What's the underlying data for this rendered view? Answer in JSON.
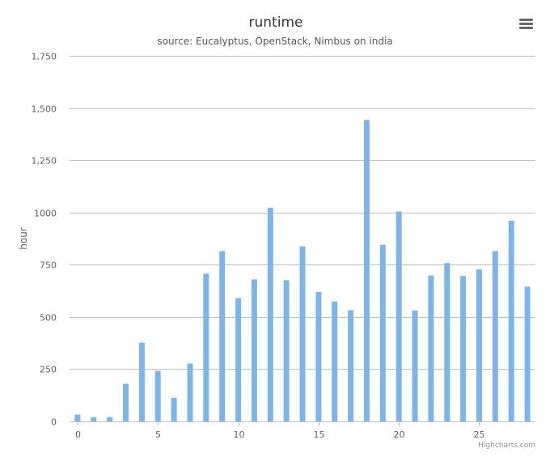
{
  "chart_data": {
    "type": "bar",
    "title": "runtime",
    "subtitle": "source: Eucalyptus, OpenStack, Nimbus on india",
    "xlabel": "",
    "ylabel": "hour",
    "x": [
      0,
      1,
      2,
      3,
      4,
      5,
      6,
      7,
      8,
      9,
      10,
      11,
      12,
      13,
      14,
      15,
      16,
      17,
      18,
      19,
      20,
      21,
      22,
      23,
      24,
      25,
      26,
      27,
      28
    ],
    "values": [
      32,
      20,
      20,
      180,
      377,
      242,
      113,
      277,
      707,
      815,
      590,
      680,
      1023,
      676,
      838,
      620,
      574,
      532,
      1443,
      845,
      1005,
      531,
      699,
      758,
      696,
      727,
      815,
      960,
      645
    ],
    "xlim": [
      -0.5,
      28.5
    ],
    "ylim": [
      0,
      1750
    ],
    "y_ticks": [
      0,
      250,
      500,
      750,
      1000,
      1250,
      1500,
      1750
    ],
    "x_ticks": [
      0,
      5,
      10,
      15,
      20,
      25
    ],
    "grid": true,
    "colors": {
      "bar": "#7cb5ec",
      "grid": "#c0c0c0",
      "axis_text": "#606060",
      "title": "#333333",
      "subtitle": "#555555"
    }
  },
  "credits": "Highcharts.com",
  "menu_icon": "hamburger-menu-icon"
}
